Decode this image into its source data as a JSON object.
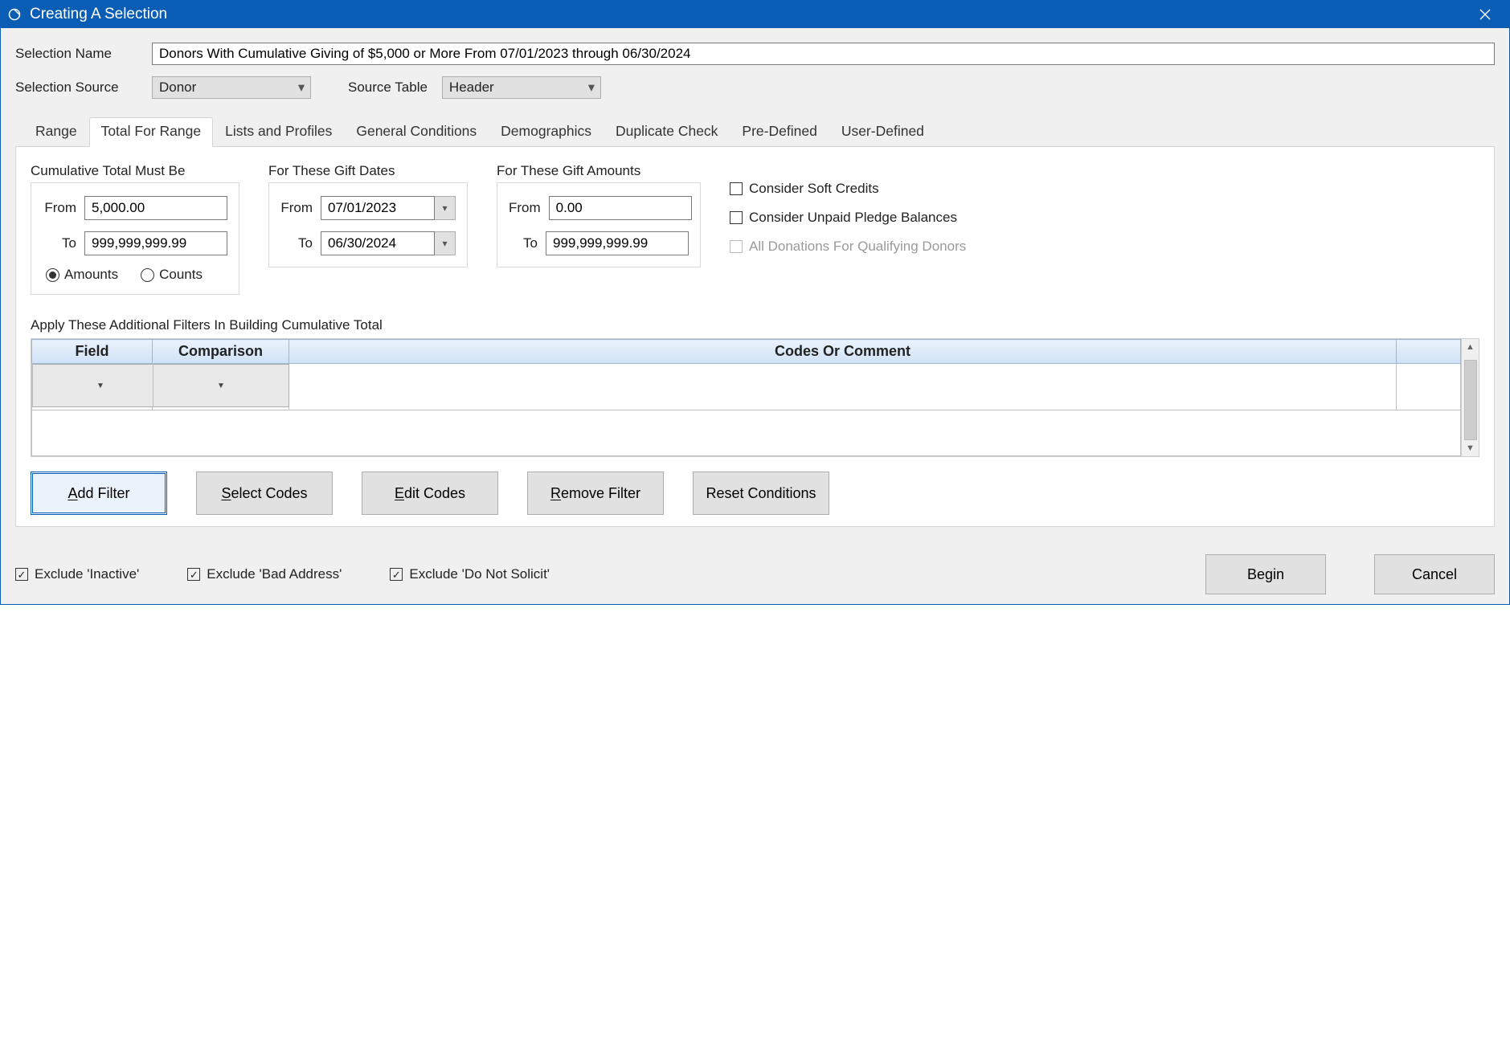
{
  "title": "Creating A Selection",
  "selection": {
    "name_label": "Selection Name",
    "name_value": "Donors With Cumulative Giving of $5,000 or More From 07/01/2023 through 06/30/2024",
    "source_label": "Selection Source",
    "source_value": "Donor",
    "source_table_label": "Source Table",
    "source_table_value": "Header"
  },
  "tabs": [
    "Range",
    "Total For Range",
    "Lists and Profiles",
    "General Conditions",
    "Demographics",
    "Duplicate Check",
    "Pre-Defined",
    "User-Defined"
  ],
  "active_tab_index": 1,
  "cumulative": {
    "title": "Cumulative Total Must Be",
    "from_label": "From",
    "from_value": "5,000.00",
    "to_label": "To",
    "to_value": "999,999,999.99",
    "radio_amounts": "Amounts",
    "radio_counts": "Counts",
    "radio_selected": "Amounts"
  },
  "gift_dates": {
    "title": "For These Gift Dates",
    "from_label": "From",
    "from_value": "07/01/2023",
    "to_label": "To",
    "to_value": "06/30/2024"
  },
  "gift_amounts": {
    "title": "For These Gift Amounts",
    "from_label": "From",
    "from_value": "0.00",
    "to_label": "To",
    "to_value": "999,999,999.99"
  },
  "options": {
    "soft_credits": "Consider Soft Credits",
    "unpaid_pledges": "Consider Unpaid Pledge Balances",
    "all_donations": "All Donations For Qualifying Donors"
  },
  "filters_title": "Apply These Additional Filters In Building Cumulative Total",
  "grid_headers": {
    "field": "Field",
    "comparison": "Comparison",
    "codes": "Codes Or Comment"
  },
  "buttons": {
    "add_filter_pre": "A",
    "add_filter_post": "dd Filter",
    "select_codes_pre": "S",
    "select_codes_post": "elect Codes",
    "edit_codes_pre": "E",
    "edit_codes_post": "dit Codes",
    "remove_filter_pre": "R",
    "remove_filter_post": "emove Filter",
    "reset_conditions": "Reset Conditions"
  },
  "footer": {
    "excl_inactive": "Exclude 'Inactive'",
    "excl_bad_address": "Exclude 'Bad Address'",
    "excl_do_not_solicit": "Exclude 'Do Not Solicit'",
    "begin": "Begin",
    "cancel": "Cancel"
  }
}
